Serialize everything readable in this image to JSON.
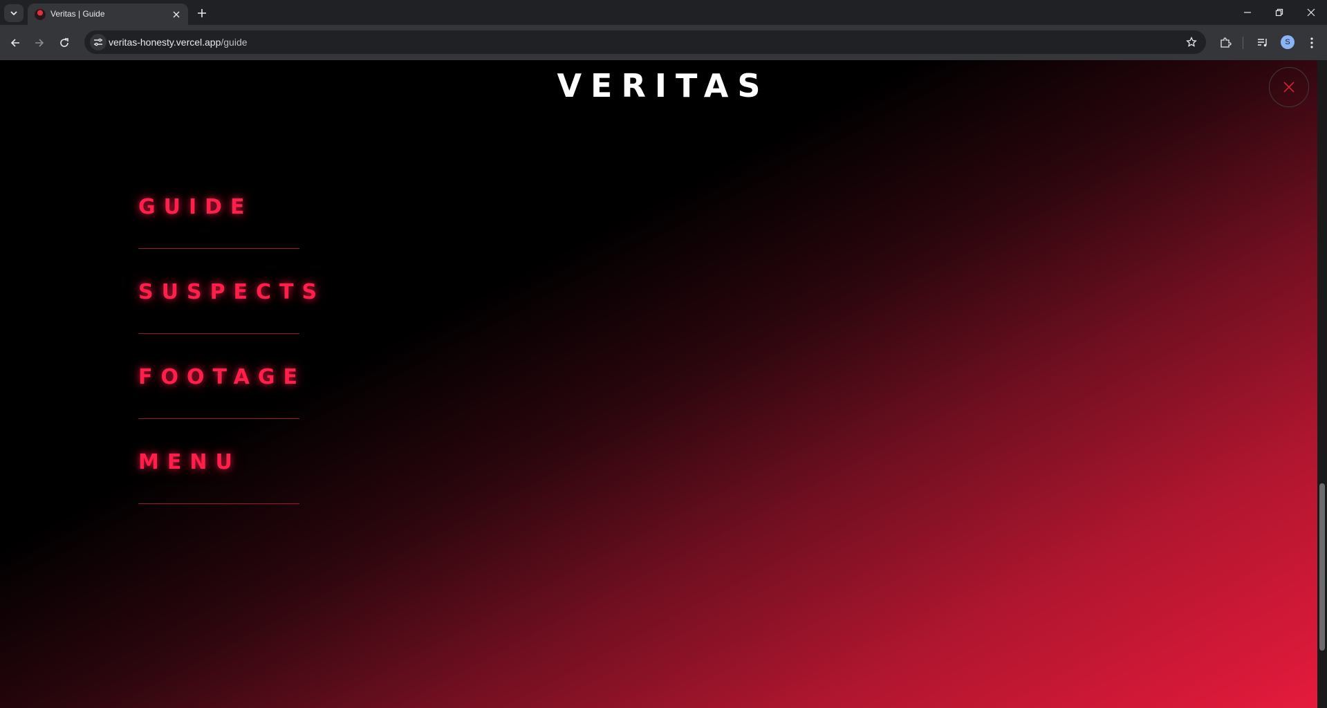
{
  "browser": {
    "tab_title": "Veritas | Guide",
    "url_host": "veritas-honesty.vercel.app",
    "url_path": "/guide",
    "profile_initial": "S"
  },
  "page": {
    "brand": "VERITAS",
    "menu_items": [
      {
        "label": "GUIDE"
      },
      {
        "label": "SUSPECTS"
      },
      {
        "label": "FOOTAGE"
      },
      {
        "label": "MENU"
      }
    ]
  },
  "colors": {
    "accent": "#ff1f4a",
    "background_dark": "#000000",
    "gradient_end": "#e61a3c"
  },
  "icons": {
    "close": "close-icon",
    "back": "back-arrow-icon",
    "forward": "forward-arrow-icon",
    "reload": "reload-icon"
  }
}
